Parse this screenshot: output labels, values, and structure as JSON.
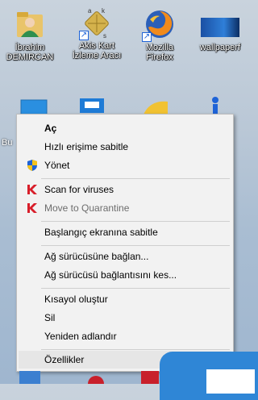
{
  "desktop": {
    "icons": [
      {
        "label_line1": "İbrahim",
        "label_line2": "DEMIRCAN",
        "icon": "user-folder-icon"
      },
      {
        "label_line1": "Akis Kart",
        "label_line2": "İzleme Aracı",
        "icon": "smart-card-icon"
      },
      {
        "label_line1": "Mozilla",
        "label_line2": "Firefox",
        "icon": "firefox-icon"
      },
      {
        "label_line1": "wallpaperf",
        "label_line2": "",
        "icon": "wallpaper-image-icon"
      }
    ],
    "partial_label": "Bu"
  },
  "menu": {
    "items": [
      {
        "label": "Aç"
      },
      {
        "label": "Hızlı erişime sabitle"
      },
      {
        "label": "Yönet",
        "icon": "admin-shield-icon"
      },
      {
        "label": "Scan for viruses",
        "icon": "kaspersky-icon"
      },
      {
        "label": "Move to Quarantine",
        "icon": "kaspersky-icon"
      },
      {
        "label": "Başlangıç ekranına sabitle"
      },
      {
        "label": "Ağ sürücüsüne bağlan..."
      },
      {
        "label": "Ağ sürücüsü bağlantısını kes..."
      },
      {
        "label": "Kısayol oluştur"
      },
      {
        "label": "Sil"
      },
      {
        "label": "Yeniden adlandır"
      },
      {
        "label": "Özellikler"
      }
    ]
  },
  "colors": {
    "kaspersky_red": "#d81e2a",
    "shield_blue": "#1e63d7",
    "shield_yellow": "#f3c21b",
    "highlight": "#e6e6e6"
  }
}
